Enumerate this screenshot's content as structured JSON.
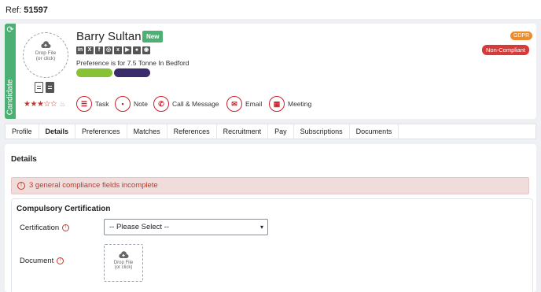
{
  "ref": {
    "label": "Ref:",
    "value": "51597"
  },
  "candidate": {
    "side_label": "Candidate",
    "avatar_drop": {
      "line1": "Drop File",
      "line2": "(or click)"
    },
    "name": "Barry Sultan",
    "new_badge": "New",
    "preference": "Preference is for 7.5 Tonne In Bedford",
    "rating": "3 of 5 stars",
    "gdpr_badge": "GDPR",
    "compliance_badge": "Non-Compliant",
    "social_icons": [
      "linkedin-icon",
      "x-icon",
      "facebook-icon",
      "instagram-icon",
      "xing-icon",
      "youtube-icon",
      "website-icon",
      "location-icon"
    ],
    "actions": [
      {
        "label": "Task",
        "icon": "task-icon"
      },
      {
        "label": "Note",
        "icon": "note-icon"
      },
      {
        "label": "Call & Message",
        "icon": "phone-icon"
      },
      {
        "label": "Email",
        "icon": "email-icon"
      },
      {
        "label": "Meeting",
        "icon": "calendar-icon"
      }
    ]
  },
  "tabs": [
    "Profile",
    "Details",
    "Preferences",
    "Matches",
    "References",
    "Recruitment",
    "Pay",
    "Subscriptions",
    "Documents"
  ],
  "active_tab": "Details",
  "details": {
    "title": "Details",
    "alert": "3 general compliance fields incomplete",
    "section_title": "Compulsory Certification",
    "certification_label": "Certification",
    "certification_value": "-- Please Select --",
    "document_label": "Document",
    "file_drop": {
      "line1": "Drop File",
      "line2": "(or click)"
    }
  },
  "colors": {
    "accent_red": "#c8232c",
    "candidate_green": "#4caf73",
    "gdpr_orange": "#ee8b2b"
  }
}
